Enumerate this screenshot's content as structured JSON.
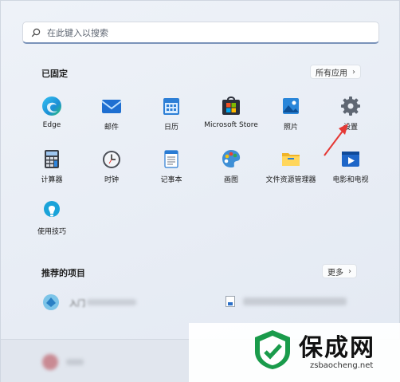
{
  "search": {
    "placeholder": "在此键入以搜索",
    "icon": "search-icon"
  },
  "pinned": {
    "title": "已固定",
    "all_apps_label": "所有应用",
    "apps": [
      {
        "label": "Edge",
        "icon": "edge-icon"
      },
      {
        "label": "邮件",
        "icon": "mail-icon"
      },
      {
        "label": "日历",
        "icon": "calendar-icon"
      },
      {
        "label": "Microsoft Store",
        "icon": "store-icon"
      },
      {
        "label": "照片",
        "icon": "photos-icon"
      },
      {
        "label": "设置",
        "icon": "gear-icon"
      },
      {
        "label": "计算器",
        "icon": "calculator-icon"
      },
      {
        "label": "时钟",
        "icon": "clock-icon"
      },
      {
        "label": "记事本",
        "icon": "notepad-icon"
      },
      {
        "label": "画图",
        "icon": "paint-icon"
      },
      {
        "label": "文件资源管理器",
        "icon": "folder-icon"
      },
      {
        "label": "电影和电视",
        "icon": "movies-icon"
      },
      {
        "label": "使用技巧",
        "icon": "tips-icon"
      }
    ]
  },
  "recommended": {
    "title": "推荐的项目",
    "more_label": "更多",
    "items": [
      {
        "label": "入门"
      }
    ]
  },
  "watermark": {
    "name": "保成网",
    "url": "zsbaocheng.net"
  },
  "colors": {
    "accent": "#0067c0",
    "annotation_arrow": "#e53935"
  }
}
